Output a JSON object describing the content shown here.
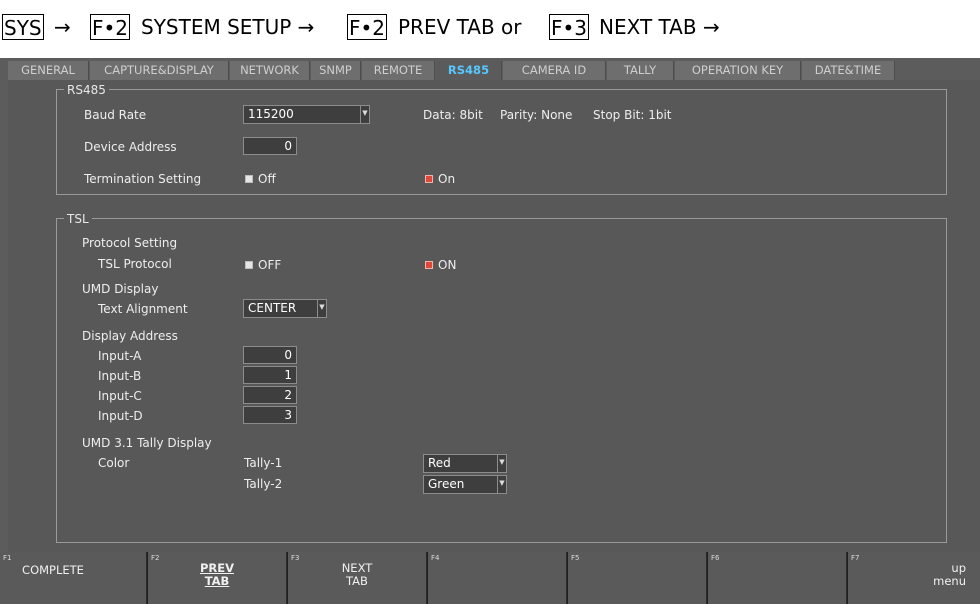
{
  "breadcrumb": {
    "sys": "SYS",
    "arrow1": "→",
    "key1": "F•2",
    "step1": "SYSTEM SETUP →",
    "key2": "F•2",
    "step2": "PREV TAB or",
    "key3": "F•3",
    "step3": "NEXT TAB →"
  },
  "tabs": [
    {
      "label": "GENERAL"
    },
    {
      "label": "CAPTURE&DISPLAY"
    },
    {
      "label": "NETWORK"
    },
    {
      "label": "SNMP"
    },
    {
      "label": "REMOTE"
    },
    {
      "label": "RS485",
      "active": true
    },
    {
      "label": "CAMERA ID"
    },
    {
      "label": "TALLY"
    },
    {
      "label": "OPERATION KEY"
    },
    {
      "label": "DATE&TIME"
    }
  ],
  "rs485": {
    "title": "RS485",
    "baud_rate_label": "Baud Rate",
    "baud_rate_value": "115200",
    "data_info": "Data: 8bit",
    "parity_info": "Parity: None",
    "stop_info": "Stop Bit: 1bit",
    "device_address_label": "Device Address",
    "device_address_value": "0",
    "termination_label": "Termination Setting",
    "termination_off": "Off",
    "termination_on": "On",
    "termination_selected": "On"
  },
  "tsl": {
    "title": "TSL",
    "protocol_setting_label": "Protocol Setting",
    "tsl_protocol_label": "TSL Protocol",
    "tsl_protocol_off": "OFF",
    "tsl_protocol_on": "ON",
    "tsl_protocol_selected": "ON",
    "umd_display_label": "UMD Display",
    "text_alignment_label": "Text Alignment",
    "text_alignment_value": "CENTER",
    "display_address_label": "Display Address",
    "inputs": [
      {
        "label": "Input-A",
        "value": "0"
      },
      {
        "label": "Input-B",
        "value": "1"
      },
      {
        "label": "Input-C",
        "value": "2"
      },
      {
        "label": "Input-D",
        "value": "3"
      }
    ],
    "umd_tally_label": "UMD 3.1 Tally Display",
    "color_label": "Color",
    "tally1_label": "Tally-1",
    "tally1_value": "Red",
    "tally2_label": "Tally-2",
    "tally2_value": "Green"
  },
  "function_keys": [
    {
      "num": "F1",
      "label": "COMPLETE"
    },
    {
      "num": "F2",
      "label": "PREV\nTAB"
    },
    {
      "num": "F3",
      "label": "NEXT\nTAB"
    },
    {
      "num": "F4",
      "label": ""
    },
    {
      "num": "F5",
      "label": ""
    },
    {
      "num": "F6",
      "label": ""
    },
    {
      "num": "F7",
      "label": "up\nmenu"
    }
  ],
  "colors": {
    "active_tab_text": "#56c8ff",
    "radio_selected": "#e0473b",
    "screen_bg": "#5c5c5c"
  }
}
